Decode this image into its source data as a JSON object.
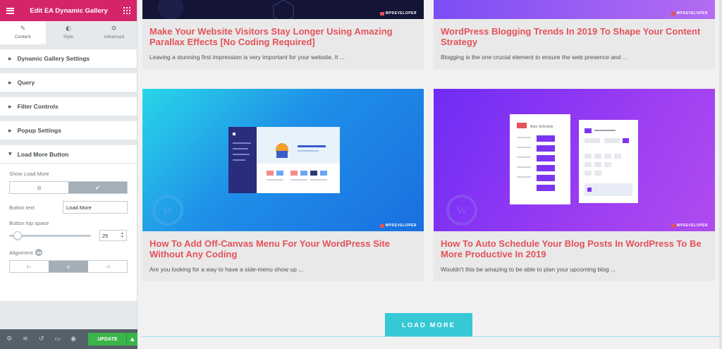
{
  "panel": {
    "title": "Edit EA Dynamic Gallery",
    "tabs": [
      {
        "label": "Content",
        "icon": "pencil-icon"
      },
      {
        "label": "Style",
        "icon": "contrast-icon"
      },
      {
        "label": "Advanced",
        "icon": "gear-icon"
      }
    ],
    "sections": [
      "Dynamic Gallery Settings",
      "Query",
      "Filter Controls",
      "Popup Settings",
      "Load More Button"
    ],
    "controls": {
      "show_load_more_label": "Show Load More",
      "button_text_label": "Button text",
      "button_text_value": "Load More",
      "top_space_label": "Button top space",
      "top_space_value": "25",
      "top_space_fraction": 0.06,
      "alignment_label": "Alignment"
    },
    "footer": {
      "update_label": "UPDATE"
    }
  },
  "posts": [
    {
      "title": "Make Your Website Visitors Stay Longer Using Amazing Parallax Effects [No Coding Required]",
      "excerpt": "Leaving a stunning first impression is very important for your website. It ..."
    },
    {
      "title": "WordPress Blogging Trends In 2019 To Shape Your Content Strategy",
      "excerpt": "Blogging is the one crucial element to ensure the web presence and ..."
    },
    {
      "title": "How To Add Off-Canvas Menu For Your WordPress Site Without Any Coding",
      "excerpt": "Are you looking for a way to have a side-menu show up ..."
    },
    {
      "title": "How To Auto Schedule Your Blog Posts In WordPress To Be More Productive In 2019",
      "excerpt": "Wouldn't this be amazing to be able to plan your upcoming blog ..."
    }
  ],
  "images": {
    "brand": "WPDEVELOPER",
    "schedule_label": "Auto Schedule"
  },
  "load_more_label": "LOAD MORE",
  "colors": {
    "accent": "#d4256b",
    "title": "#e4525a",
    "button": "#37c8d6",
    "update": "#39b54a"
  }
}
